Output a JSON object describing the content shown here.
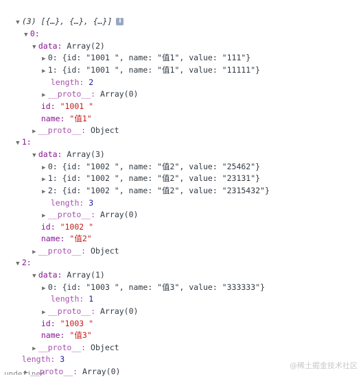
{
  "header": {
    "summary": "(3) [{…}, {…}, {…}]",
    "info_icon": "i"
  },
  "labels": {
    "k0": "0:",
    "k1": "1:",
    "k2": "2:",
    "data": "data:",
    "id": "id:",
    "name": "name:",
    "length": "length:",
    "proto": "__proto__",
    "colon": ":"
  },
  "values": {
    "array2": "Array(2)",
    "array3": "Array(3)",
    "array1": "Array(1)",
    "array0": "Array(0)",
    "object": "Object",
    "len2": "2",
    "len3": "3",
    "len1": "1",
    "outer_len": "3"
  },
  "items": [
    {
      "index": "0:",
      "id": "\"1001 \"",
      "name": "\"值1\"",
      "rows": [
        "0: {id: \"1001 \", name: \"值1\", value: \"111\"}",
        "1: {id: \"1001 \", name: \"值1\", value: \"11111\"}"
      ]
    },
    {
      "index": "1:",
      "id": "\"1002 \"",
      "name": "\"值2\"",
      "rows": [
        "0: {id: \"1002 \", name: \"值2\", value: \"25462\"}",
        "1: {id: \"1002 \", name: \"值2\", value: \"23131\"}",
        "2: {id: \"1002 \", name: \"值2\", value: \"2315432\"}"
      ]
    },
    {
      "index": "2:",
      "id": "\"1003 \"",
      "name": "\"值3\"",
      "rows": [
        "0: {id: \"1003 \", name: \"值3\", value: \"333333\"}"
      ]
    }
  ],
  "footer_cut": "undefined",
  "watermark": "@稀土掘金技术社区",
  "colors": {
    "key": "#881391",
    "string": "#c41a16",
    "number": "#1a1aa6"
  }
}
